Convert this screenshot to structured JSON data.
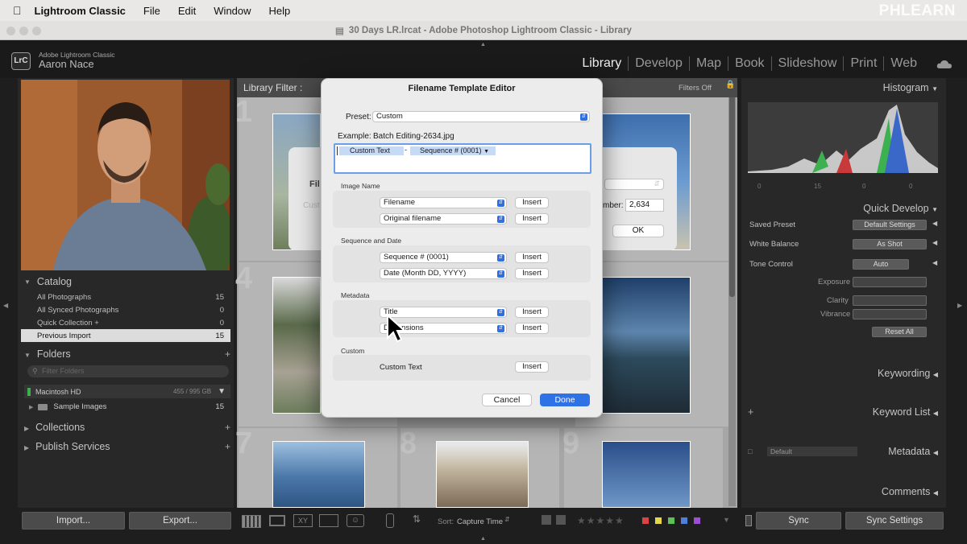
{
  "menubar": {
    "app": "Lightroom Classic",
    "items": [
      "File",
      "Edit",
      "Window",
      "Help"
    ]
  },
  "watermark": "PHLEARN",
  "window_title": "30 Days LR.lrcat - Adobe Photoshop Lightroom Classic - Library",
  "identity": {
    "logo": "LrC",
    "subtitle": "Adobe Lightroom Classic",
    "name": "Aaron Nace"
  },
  "modules": [
    "Library",
    "Develop",
    "Map",
    "Book",
    "Slideshow",
    "Print",
    "Web"
  ],
  "active_module": "Library",
  "catalog": {
    "title": "Catalog",
    "rows": [
      {
        "label": "All Photographs",
        "count": "15"
      },
      {
        "label": "All Synced Photographs",
        "count": "0"
      },
      {
        "label": "Quick Collection +",
        "count": "0"
      },
      {
        "label": "Previous Import",
        "count": "15"
      }
    ]
  },
  "folders": {
    "title": "Folders",
    "search_placeholder": "Filter Folders",
    "volume": "Macintosh HD",
    "volume_size": "455 / 995 GB",
    "folder": "Sample Images",
    "folder_count": "15"
  },
  "collections": {
    "title": "Collections"
  },
  "publish": {
    "title": "Publish Services"
  },
  "left_buttons": {
    "import": "Import...",
    "export": "Export..."
  },
  "filter": {
    "label": "Library Filter :",
    "status": "Filters Off"
  },
  "grid_numbers": [
    "1",
    "4",
    "7",
    "8",
    "9"
  ],
  "bg_dialog": {
    "label_fi": "Fil",
    "label_cust": "Cust",
    "number_label": "mber:",
    "number_value": "2,634",
    "ok": "OK"
  },
  "dialog": {
    "title": "Filename Template Editor",
    "preset_label": "Preset:",
    "preset_value": "Custom",
    "example_label": "Example:",
    "example_value": "Batch Editing-2634.jpg",
    "token_custom": "Custom Text",
    "token_sep": "-",
    "token_seq": "Sequence # (0001)",
    "groups": {
      "image_name": {
        "label": "Image Name",
        "rows": [
          {
            "value": "Filename"
          },
          {
            "value": "Original filename"
          }
        ]
      },
      "sequence": {
        "label": "Sequence and Date",
        "rows": [
          {
            "value": "Sequence # (0001)"
          },
          {
            "value": "Date (Month DD, YYYY)"
          }
        ]
      },
      "metadata": {
        "label": "Metadata",
        "rows": [
          {
            "value": "Title"
          },
          {
            "value": "Dimensions"
          }
        ]
      },
      "custom": {
        "label": "Custom",
        "text": "Custom Text"
      }
    },
    "insert": "Insert",
    "cancel": "Cancel",
    "done": "Done"
  },
  "right": {
    "histogram": "Histogram",
    "histo_info": [
      "0",
      "15",
      "0",
      "0"
    ],
    "quick_develop": "Quick Develop",
    "saved_preset_label": "Saved Preset",
    "saved_preset_value": "Default Settings",
    "wb_label": "White Balance",
    "wb_value": "As Shot",
    "tone_label": "Tone Control",
    "auto": "Auto",
    "exposure": "Exposure",
    "clarity": "Clarity",
    "vibrance": "Vibrance",
    "reset": "Reset All",
    "keywording": "Keywording",
    "keyword_list": "Keyword List",
    "metadata_select": "Default",
    "metadata": "Metadata",
    "comments": "Comments"
  },
  "toolbar": {
    "sort_label": "Sort:",
    "sort_value": "Capture Time"
  },
  "sync": {
    "sync": "Sync",
    "settings": "Sync Settings"
  },
  "colors": {
    "accent": "#2f72e6",
    "selection": "#dcdcdc"
  }
}
